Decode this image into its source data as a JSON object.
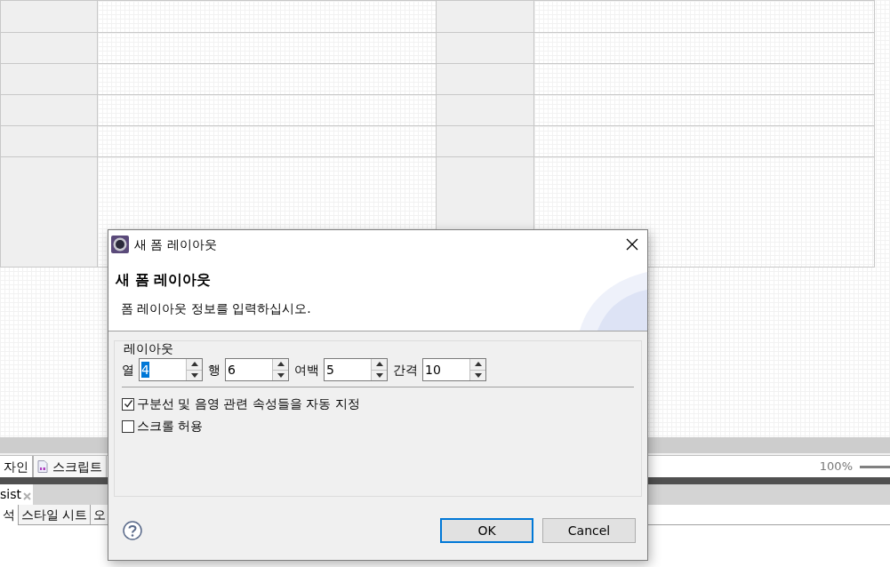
{
  "editor_tabs": [
    {
      "label": "자인",
      "selected": true,
      "kind": "plain"
    },
    {
      "label": "스크립트",
      "selected": false,
      "kind": "script"
    }
  ],
  "zoom": {
    "reading": "100%"
  },
  "panel_tabs": [
    {
      "label": "sist"
    }
  ],
  "sub_tabs": [
    {
      "label": "석",
      "selected": true
    },
    {
      "label": "스타일 시트",
      "selected": false
    },
    {
      "label": "오",
      "selected": false
    }
  ],
  "dialog": {
    "title": "새 폼 레이아웃",
    "header_title": "새 폼 레이아웃",
    "header_message": "폼 레이아웃 정보를 입력하십시오.",
    "group": {
      "label": "레이아웃",
      "spinners": [
        {
          "label": "열",
          "value": "4",
          "text_selected": true
        },
        {
          "label": "행",
          "value": "6",
          "text_selected": false
        },
        {
          "label": "여백",
          "value": "5",
          "text_selected": false
        },
        {
          "label": "간격",
          "value": "10",
          "text_selected": false
        }
      ],
      "checkboxes": [
        {
          "label": "구분선 및 음영 관련 속성들을 자동 지정",
          "checked": true
        },
        {
          "label": "스크롤 허용",
          "checked": false
        }
      ]
    },
    "buttons": [
      {
        "label": "OK",
        "default": true
      },
      {
        "label": "Cancel",
        "default": false
      }
    ]
  }
}
